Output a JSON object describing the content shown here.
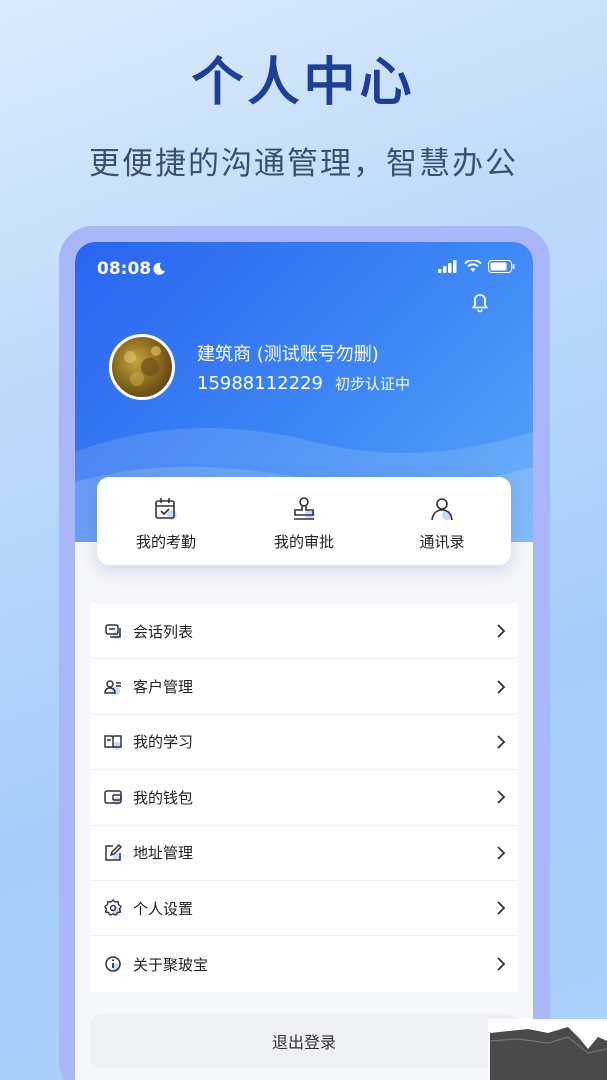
{
  "promo": {
    "title": "个人中心",
    "subtitle": "更便捷的沟通管理，智慧办公"
  },
  "status_bar": {
    "time": "08:08",
    "icons": [
      "moon-icon",
      "signal-icon",
      "wifi-icon",
      "battery-icon"
    ]
  },
  "profile": {
    "name": "建筑商 (测试账号勿删)",
    "phone": "15988112229",
    "cert_status": "初步认证中"
  },
  "quick_actions": [
    {
      "label": "我的考勤",
      "icon": "calendar-check-icon"
    },
    {
      "label": "我的审批",
      "icon": "stamp-icon"
    },
    {
      "label": "通讯录",
      "icon": "contacts-icon"
    }
  ],
  "menu": [
    {
      "label": "会话列表",
      "icon": "chat-icon"
    },
    {
      "label": "客户管理",
      "icon": "customer-icon"
    },
    {
      "label": "我的学习",
      "icon": "book-icon"
    },
    {
      "label": "我的钱包",
      "icon": "wallet-icon"
    },
    {
      "label": "地址管理",
      "icon": "edit-address-icon"
    },
    {
      "label": "个人设置",
      "icon": "settings-icon"
    },
    {
      "label": "关于聚玻宝",
      "icon": "info-icon"
    }
  ],
  "logout_label": "退出登录",
  "colors": {
    "brand_blue": "#2a64f0",
    "promo_title": "#1d3f96",
    "frame": "#a9b6f7"
  }
}
